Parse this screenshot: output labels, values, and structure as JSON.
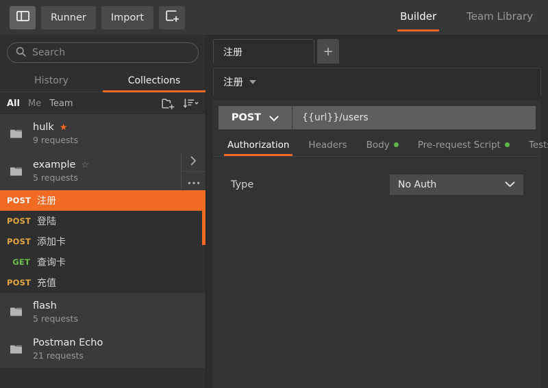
{
  "topbar": {
    "sidebar_toggle_label": "sidebar-toggle",
    "runner_label": "Runner",
    "import_label": "Import",
    "new_tab_label": "new-window",
    "tabs": [
      {
        "label": "Builder",
        "active": true
      },
      {
        "label": "Team Library",
        "active": false
      }
    ]
  },
  "sidebar": {
    "search": {
      "placeholder": "Search",
      "value": ""
    },
    "tabs": [
      {
        "label": "History",
        "active": false
      },
      {
        "label": "Collections",
        "active": true
      }
    ],
    "filters": [
      {
        "label": "All",
        "state": "active"
      },
      {
        "label": "Me",
        "state": "dim"
      },
      {
        "label": "Team",
        "state": "mid"
      }
    ],
    "actions": [
      {
        "name": "new-folder-icon"
      },
      {
        "name": "sort-icon"
      }
    ],
    "collections": [
      {
        "name": "hulk",
        "count": "9 requests",
        "starred": true,
        "hovered": false
      },
      {
        "name": "example",
        "count": "5 requests",
        "starred": false,
        "hovered": true
      },
      {
        "name": "flash",
        "count": "5 requests",
        "starred": false,
        "hovered": false
      },
      {
        "name": "Postman Echo",
        "count": "21 requests",
        "starred": false,
        "hovered": false
      }
    ],
    "requests": [
      {
        "method": "POST",
        "name": "注册",
        "selected": true
      },
      {
        "method": "POST",
        "name": "登陆",
        "selected": false
      },
      {
        "method": "POST",
        "name": "添加卡",
        "selected": false
      },
      {
        "method": "GET",
        "name": "查询卡",
        "selected": false
      },
      {
        "method": "POST",
        "name": "充值",
        "selected": false
      }
    ]
  },
  "main": {
    "request_tabs": [
      {
        "label": "注册",
        "active": true
      }
    ],
    "add_tab_label": "+",
    "breadcrumb": {
      "name": "注册"
    },
    "request": {
      "method": "POST",
      "url": "{{url}}/users",
      "subtabs": [
        {
          "label": "Authorization",
          "active": true,
          "dot": false
        },
        {
          "label": "Headers",
          "active": false,
          "dot": false
        },
        {
          "label": "Body",
          "active": false,
          "dot": true
        },
        {
          "label": "Pre-request Script",
          "active": false,
          "dot": true
        },
        {
          "label": "Tests",
          "active": false,
          "dot": true
        }
      ],
      "auth": {
        "type_label": "Type",
        "type_value": "No Auth"
      }
    }
  },
  "colors": {
    "accent": "#f06a23",
    "green_dot": "#5eb84a",
    "post": "#e3a640",
    "get": "#6dbf4b",
    "bg": "#2c2c2c",
    "sidebar_bg": "#2f2f2f",
    "topbar_bg": "#373737"
  }
}
